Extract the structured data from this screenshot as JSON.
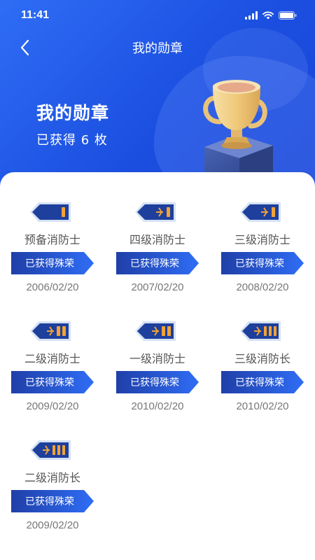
{
  "status": {
    "time": "11:41"
  },
  "nav": {
    "title": "我的勋章"
  },
  "hero": {
    "title": "我的勋章",
    "subtitle": "已获得 6 枚"
  },
  "medals": [
    {
      "name": "预备消防士",
      "status": "已获得殊荣",
      "date": "2006/02/20"
    },
    {
      "name": "四级消防士",
      "status": "已获得殊荣",
      "date": "2007/02/20"
    },
    {
      "name": "三级消防士",
      "status": "已获得殊荣",
      "date": "2008/02/20"
    },
    {
      "name": "二级消防士",
      "status": "已获得殊荣",
      "date": "2009/02/20"
    },
    {
      "name": "一级消防士",
      "status": "已获得殊荣",
      "date": "2010/02/20"
    },
    {
      "name": "三级消防长",
      "status": "已获得殊荣",
      "date": "2010/02/20"
    },
    {
      "name": "二级消防长",
      "status": "已获得殊荣",
      "date": "2009/02/20"
    }
  ],
  "colors": {
    "primary": "#1b4fe0",
    "badge_gold": "#f2a236",
    "ribbon_start": "#1f3fa8",
    "ribbon_end": "#2f6df5"
  }
}
